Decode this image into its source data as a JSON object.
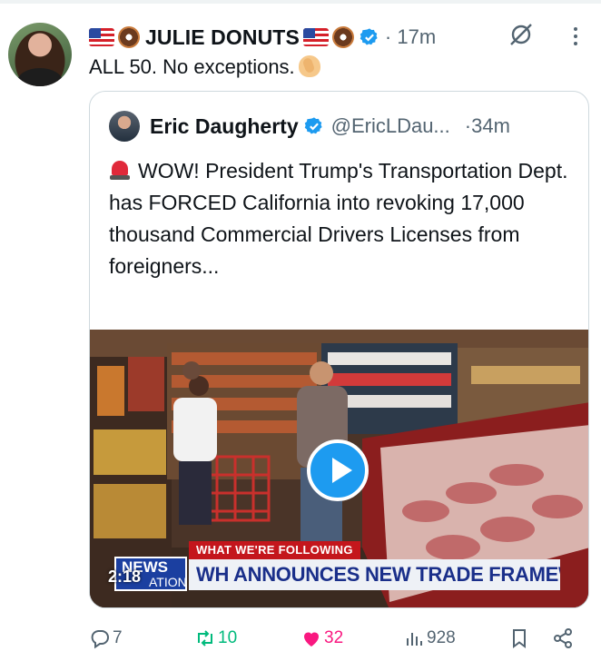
{
  "post": {
    "author_name": "JULIE DONUTS",
    "time": "17m",
    "text": "ALL 50. No exceptions.",
    "text_emoji": "clapping-hands-icon"
  },
  "quoted": {
    "author_name": "Eric Daugherty",
    "handle": "@EricLDau...",
    "time": "·34m",
    "text": "WOW! President Trump's Transportation Dept. has FORCED California into revoking 17,000 thousand Commercial Drivers Licenses from foreigners...",
    "lead_emoji": "police-siren-icon",
    "video": {
      "chyron_top": "WHAT WE'RE FOLLOWING",
      "chyron_main": "WH ANNOUNCES NEW TRADE FRAMEWORKS",
      "logo_top": "NEWS",
      "logo_bottom": "ATION",
      "timer": "2:18"
    }
  },
  "actions": {
    "replies": "7",
    "reposts": "10",
    "likes": "32",
    "views": "928"
  },
  "colors": {
    "accent": "#1d9bf0",
    "like": "#f91880",
    "repost": "#00ba7c",
    "muted": "#536471"
  }
}
